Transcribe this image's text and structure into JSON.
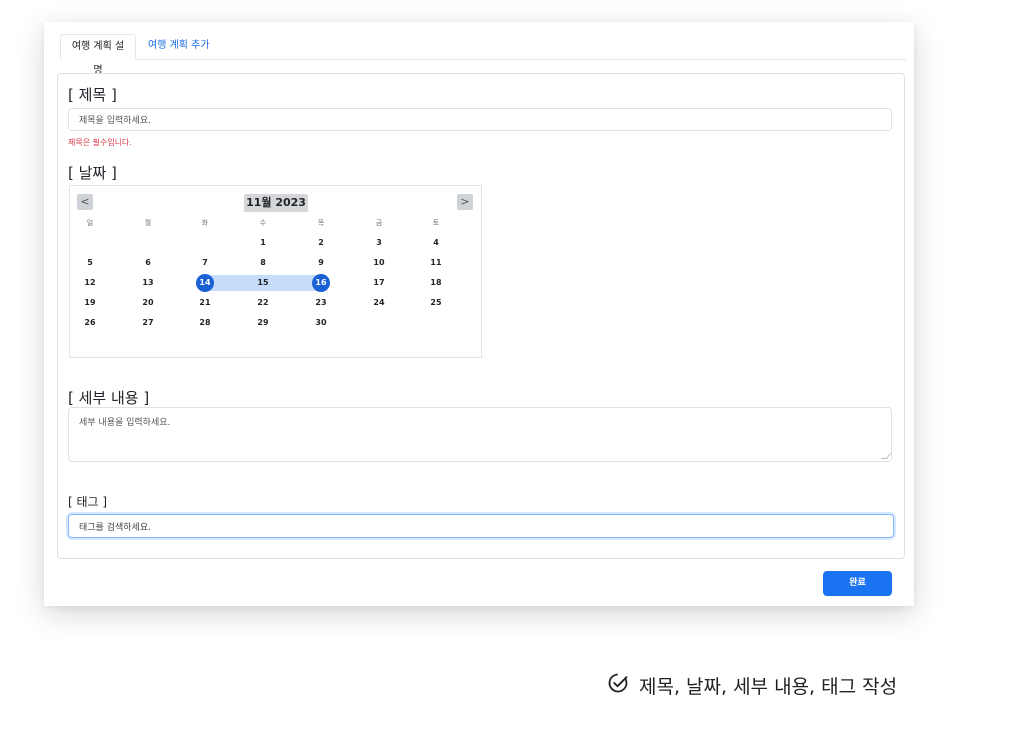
{
  "tabs": {
    "active": "여행 계획 설명",
    "other": "여행 계획 추가"
  },
  "title_section": {
    "label": "[ 제목 ]",
    "placeholder": "제목을 입력하세요.",
    "error": "제목은 필수입니다."
  },
  "date_section": {
    "label": "[ 날짜 ]",
    "calendar": {
      "month_label": "11월 2023",
      "prev": "<",
      "next": ">",
      "weekdays": [
        "일",
        "월",
        "화",
        "수",
        "목",
        "금",
        "토"
      ],
      "weeks": [
        [
          "",
          "",
          "",
          "1",
          "2",
          "3",
          "4"
        ],
        [
          "5",
          "6",
          "7",
          "8",
          "9",
          "10",
          "11"
        ],
        [
          "12",
          "13",
          "14",
          "15",
          "16",
          "17",
          "18"
        ],
        [
          "19",
          "20",
          "21",
          "22",
          "23",
          "24",
          "25"
        ],
        [
          "26",
          "27",
          "28",
          "29",
          "30",
          "",
          ""
        ]
      ],
      "range_start": "14",
      "range_end": "16"
    }
  },
  "detail_section": {
    "label": "[ 세부 내용 ]",
    "placeholder": "세부 내용을 입력하세요."
  },
  "tag_section": {
    "label": "[ 태그 ]",
    "placeholder": "태그를 검색하세요."
  },
  "done_button": "완료",
  "caption": "제목, 날짜, 세부 내용, 태그 작성",
  "colors": {
    "accent": "#1a73f0",
    "selected": "#1a61d6",
    "range": "#c6dcfb",
    "error": "#dc3545"
  }
}
